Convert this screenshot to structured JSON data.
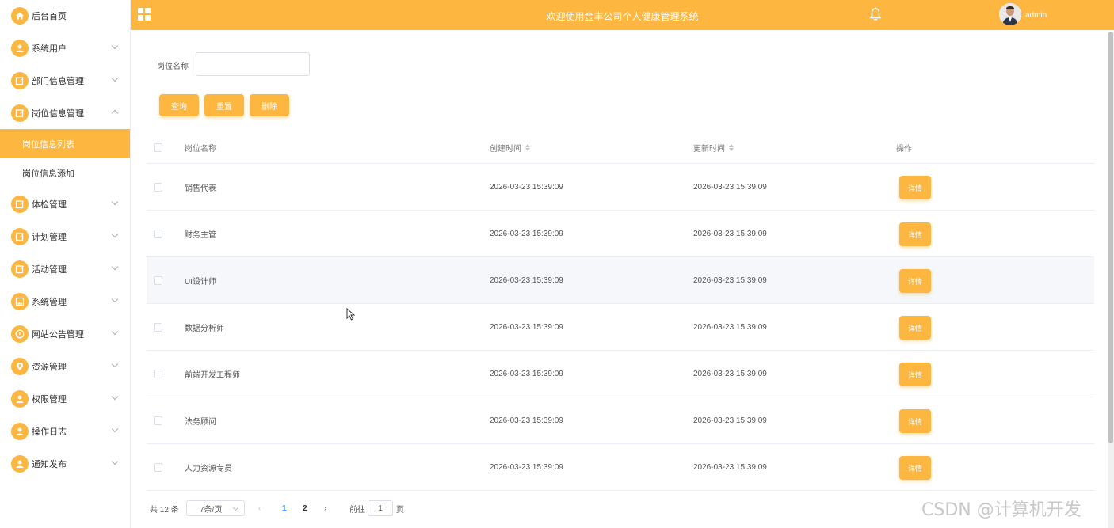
{
  "sidebar": {
    "items": [
      {
        "label": "后台首页",
        "icon": "home-icon",
        "chevron": "none"
      },
      {
        "label": "系统用户",
        "icon": "user-icon",
        "chevron": "down"
      },
      {
        "label": "部门信息管理",
        "icon": "edit-icon",
        "chevron": "down"
      },
      {
        "label": "岗位信息管理",
        "icon": "edit-icon",
        "chevron": "up"
      },
      {
        "label": "体检管理",
        "icon": "edit-icon",
        "chevron": "down"
      },
      {
        "label": "计划管理",
        "icon": "edit-icon",
        "chevron": "down"
      },
      {
        "label": "活动管理",
        "icon": "edit-icon",
        "chevron": "down"
      },
      {
        "label": "系统管理",
        "icon": "picture-icon",
        "chevron": "down"
      },
      {
        "label": "网站公告管理",
        "icon": "info-icon",
        "chevron": "down"
      },
      {
        "label": "资源管理",
        "icon": "location-icon",
        "chevron": "down"
      },
      {
        "label": "权限管理",
        "icon": "user-icon",
        "chevron": "down"
      },
      {
        "label": "操作日志",
        "icon": "user-icon",
        "chevron": "down"
      },
      {
        "label": "通知发布",
        "icon": "user-icon",
        "chevron": "down"
      }
    ],
    "submenu": [
      {
        "label": "岗位信息列表",
        "active": true
      },
      {
        "label": "岗位信息添加",
        "active": false
      }
    ]
  },
  "header": {
    "title": "欢迎使用金丰公司个人健康管理系统",
    "username": "admin"
  },
  "search": {
    "label": "岗位名称",
    "value": "",
    "buttons": {
      "query": "查询",
      "reset": "重置",
      "delete": "删除"
    }
  },
  "table": {
    "columns": {
      "name": "岗位名称",
      "created": "创建时间",
      "updated": "更新时间",
      "op": "操作"
    },
    "detail_label": "详情",
    "rows": [
      {
        "name": "销售代表",
        "created": "2026-03-23 15:39:09",
        "updated": "2026-03-23 15:39:09"
      },
      {
        "name": "财务主管",
        "created": "2026-03-23 15:39:09",
        "updated": "2026-03-23 15:39:09"
      },
      {
        "name": "UI设计师",
        "created": "2026-03-23 15:39:09",
        "updated": "2026-03-23 15:39:09"
      },
      {
        "name": "数据分析师",
        "created": "2026-03-23 15:39:09",
        "updated": "2026-03-23 15:39:09"
      },
      {
        "name": "前端开发工程师",
        "created": "2026-03-23 15:39:09",
        "updated": "2026-03-23 15:39:09"
      },
      {
        "name": "法务顾问",
        "created": "2026-03-23 15:39:09",
        "updated": "2026-03-23 15:39:09"
      },
      {
        "name": "人力资源专员",
        "created": "2026-03-23 15:39:09",
        "updated": "2026-03-23 15:39:09"
      }
    ]
  },
  "pagination": {
    "total": "共 12 条",
    "page_size": "7条/页",
    "pages": [
      "1",
      "2"
    ],
    "current": "1",
    "goto_label": "前往",
    "goto_value": "1",
    "page_suffix": "页"
  },
  "watermark": "CSDN @计算机开发",
  "colors": {
    "accent": "#fdb63f",
    "link": "#409eff"
  }
}
